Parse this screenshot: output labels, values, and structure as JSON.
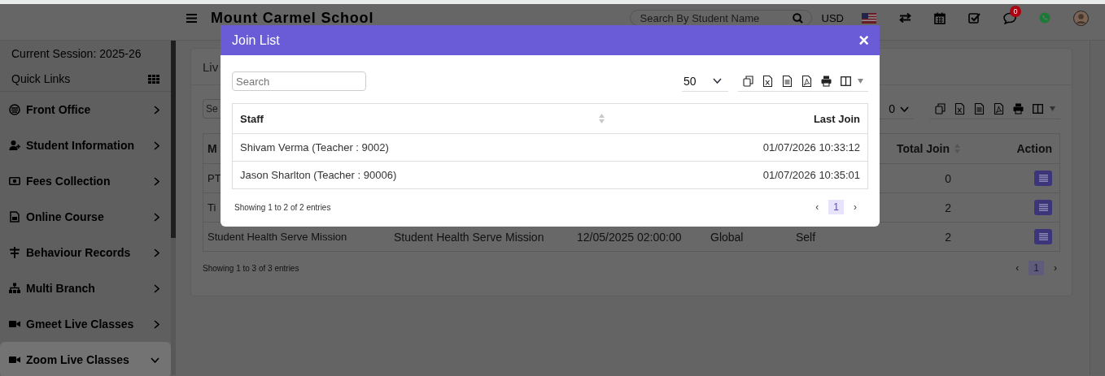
{
  "header": {
    "title": "Mount Carmel School",
    "search_placeholder": "Search By Student Name",
    "currency": "USD",
    "message_count": "0"
  },
  "sidebar": {
    "session": "Current Session: 2025-26",
    "quick_links": "Quick Links",
    "items": [
      {
        "label": "Front Office",
        "expanded": false,
        "selected": false
      },
      {
        "label": "Student Information",
        "expanded": false,
        "selected": false
      },
      {
        "label": "Fees Collection",
        "expanded": false,
        "selected": false
      },
      {
        "label": "Online Course",
        "expanded": false,
        "selected": false
      },
      {
        "label": "Behaviour Records",
        "expanded": false,
        "selected": false
      },
      {
        "label": "Multi Branch",
        "expanded": false,
        "selected": false
      },
      {
        "label": "Gmeet Live Classes",
        "expanded": false,
        "selected": false
      },
      {
        "label": "Zoom Live Classes",
        "expanded": true,
        "selected": true
      }
    ]
  },
  "page": {
    "title": "Liv",
    "search_placeholder": "Se",
    "page_size": "0",
    "columns": [
      {
        "label": "M",
        "sortable": false
      },
      {
        "label": "Total Join",
        "sortable": true
      },
      {
        "label": "Action",
        "sortable": false
      }
    ],
    "rows": [
      {
        "cells": [
          "PT"
        ],
        "total_join": "0"
      },
      {
        "cells": [
          "Ti"
        ],
        "total_join": "2"
      },
      {
        "cells": [
          "Student Health Serve Mission",
          "Student Health Serve Mission",
          "12/05/2025 02:00:00",
          "Global",
          "Self"
        ],
        "total_join": "2"
      }
    ],
    "info": "Showing 1 to 3 of 3 entries",
    "prev": "‹",
    "next": "›",
    "pages": [
      {
        "label": "1",
        "selected": true
      }
    ]
  },
  "modal": {
    "title": "Join List",
    "close": "×",
    "search_placeholder": "Search",
    "page_size": "50",
    "columns": [
      {
        "label": "Staff",
        "sortable": true
      },
      {
        "label": "Last Join",
        "sortable": false
      }
    ],
    "rows": [
      {
        "staff": "Shivam Verma (Teacher : 9002)",
        "last_join": "01/07/2026 10:33:12"
      },
      {
        "staff": "Jason Sharlton (Teacher : 90006)",
        "last_join": "01/07/2026 10:35:01"
      }
    ],
    "info": "Showing 1 to 2 of 2 entries",
    "prev": "‹",
    "next": "›",
    "pages": [
      {
        "label": "1",
        "selected": true
      }
    ]
  }
}
